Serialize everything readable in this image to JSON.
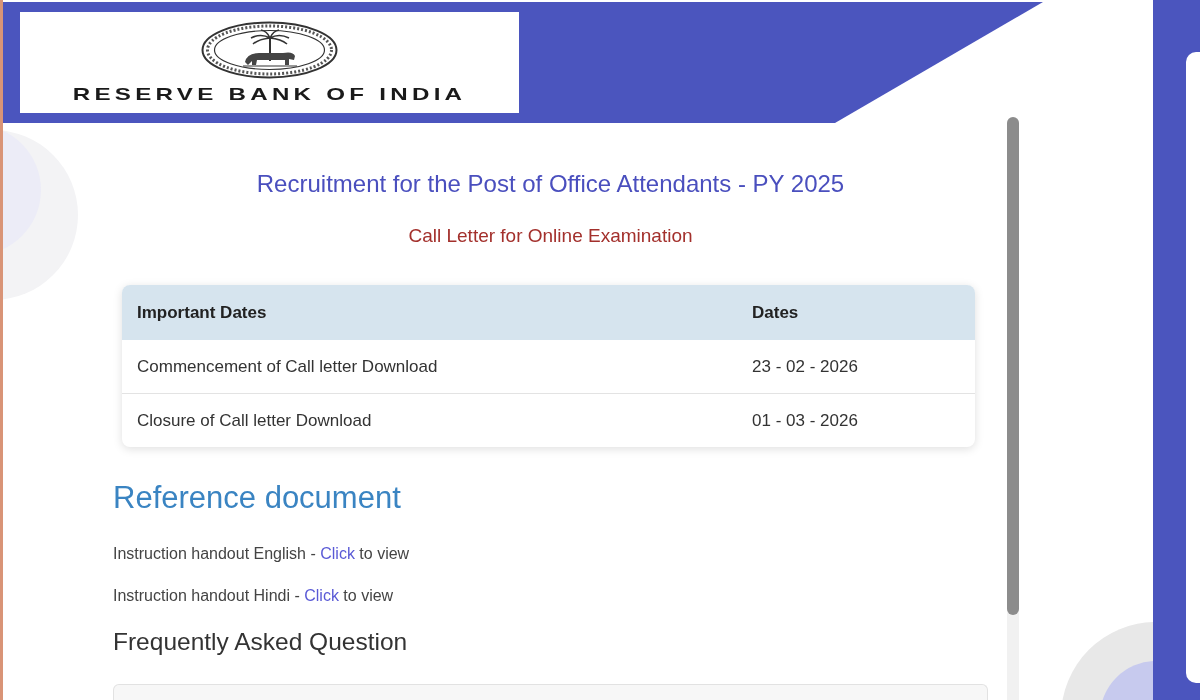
{
  "header": {
    "logo_text": "RESERVE BANK OF INDIA"
  },
  "page": {
    "title": "Recruitment for the Post of Office Attendants - PY 2025",
    "subtitle": "Call Letter for Online Examination"
  },
  "dates_table": {
    "columns": [
      "Important Dates",
      "Dates"
    ],
    "rows": [
      [
        "Commencement of Call letter Download",
        "23 - 02 - 2026"
      ],
      [
        "Closure of Call letter Download",
        "01 - 03 - 2026"
      ]
    ]
  },
  "reference": {
    "heading": "Reference document",
    "items": [
      {
        "text": "Instruction handout English -",
        "link": "Click",
        "after": "to view"
      },
      {
        "text": "Instruction handout Hindi -",
        "link": "Click",
        "after": "to view"
      }
    ]
  },
  "faq": {
    "heading": "Frequently Asked Question"
  }
}
